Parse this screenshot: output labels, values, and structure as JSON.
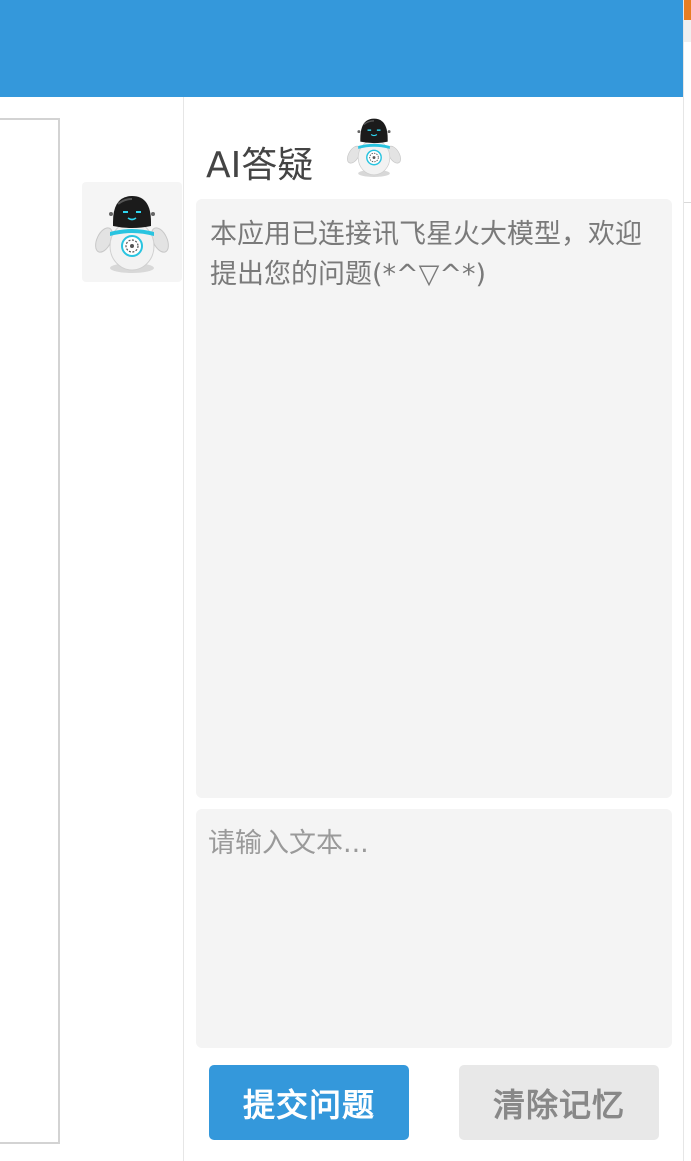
{
  "ai_panel": {
    "title": "AI答疑",
    "welcome_message": "本应用已连接讯飞星火大模型，欢迎提出您的问题(*^▽^*)",
    "input_placeholder": "请输入文本...",
    "submit_label": "提交问题",
    "clear_label": "清除记忆"
  },
  "icons": {
    "launcher": "robot-icon",
    "title": "robot-icon"
  },
  "colors": {
    "primary": "#3498db",
    "panel_bg": "#f4f4f4",
    "clear_button_bg": "#e8e8e8"
  }
}
